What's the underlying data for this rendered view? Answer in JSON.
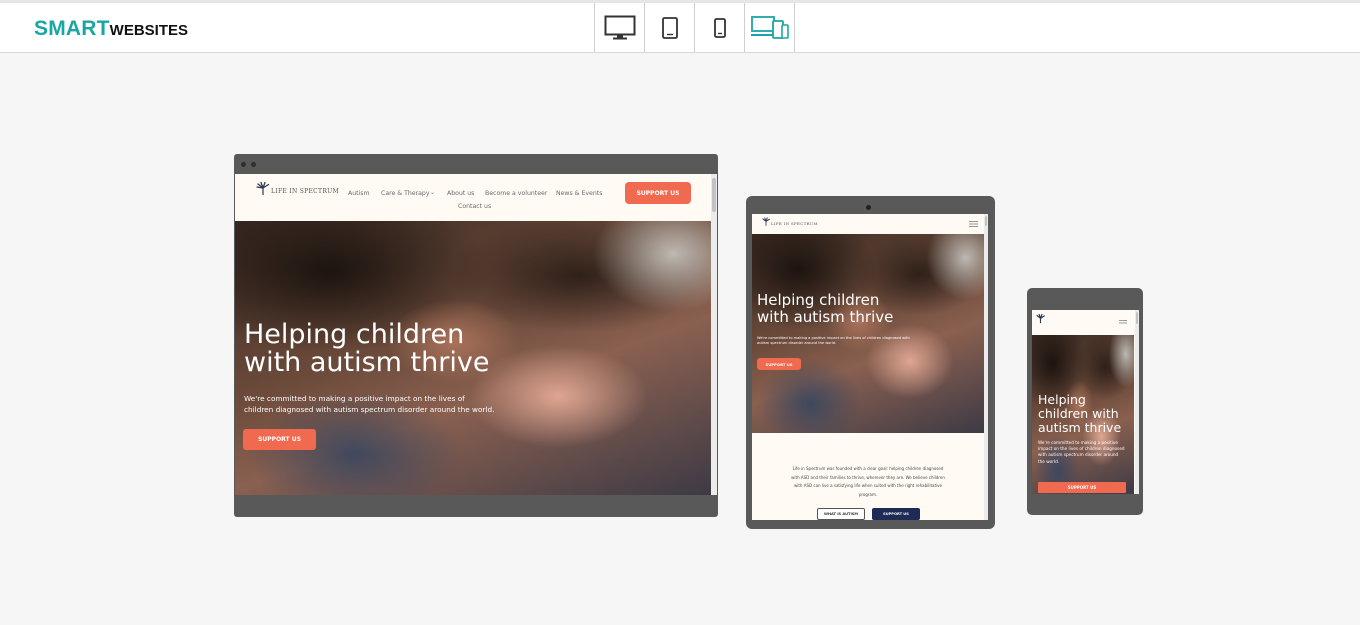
{
  "header": {
    "logo_primary": "SMART",
    "logo_secondary": "WEBSITES",
    "device_buttons": [
      {
        "icon": "desktop-icon"
      },
      {
        "icon": "tablet-icon"
      },
      {
        "icon": "mobile-icon"
      },
      {
        "icon": "all-devices-icon",
        "active": true
      }
    ],
    "accent_color": "#1aa6a6"
  },
  "site": {
    "brand": "LIFE IN SPECTRUM",
    "nav": [
      "Autism",
      "Care & Therapy",
      "About us",
      "Become a volunteer",
      "News & Events",
      "Contact us"
    ],
    "support_button": "SUPPORT US",
    "hero_title_line1": "Helping children",
    "hero_title_line2": "with autism thrive",
    "hero_text_line1": "We're committed to making a positive impact on the lives of",
    "hero_text_line2": "children diagnosed with autism spectrum disorder around the world.",
    "tablet_hero_text": "We're committed to making a positive impact on the lives of children diagnosed with autism spectrum disorder around the world.",
    "mobile_title_line1": "Helping",
    "mobile_title_line2": "children with",
    "mobile_title_line3": "autism thrive",
    "mobile_hero_text": "We're committed to making a positive impact on the lives of children diagnosed with autism spectrum disorder around the world.",
    "about_text_line1": "Life in Spectrum was founded with a clear goal: helping children diagnosed",
    "about_text_line2": "with ASD and their families to thrive, wherever they are. We believe children",
    "about_text_line3": "with ASD can live a satisfying life when suited with the right rehabilitative",
    "about_text_line4": "program.",
    "what_is_autism_button": "WHAT IS AUTISM",
    "coral_color": "#f06a50",
    "navy_color": "#1d2b55"
  }
}
